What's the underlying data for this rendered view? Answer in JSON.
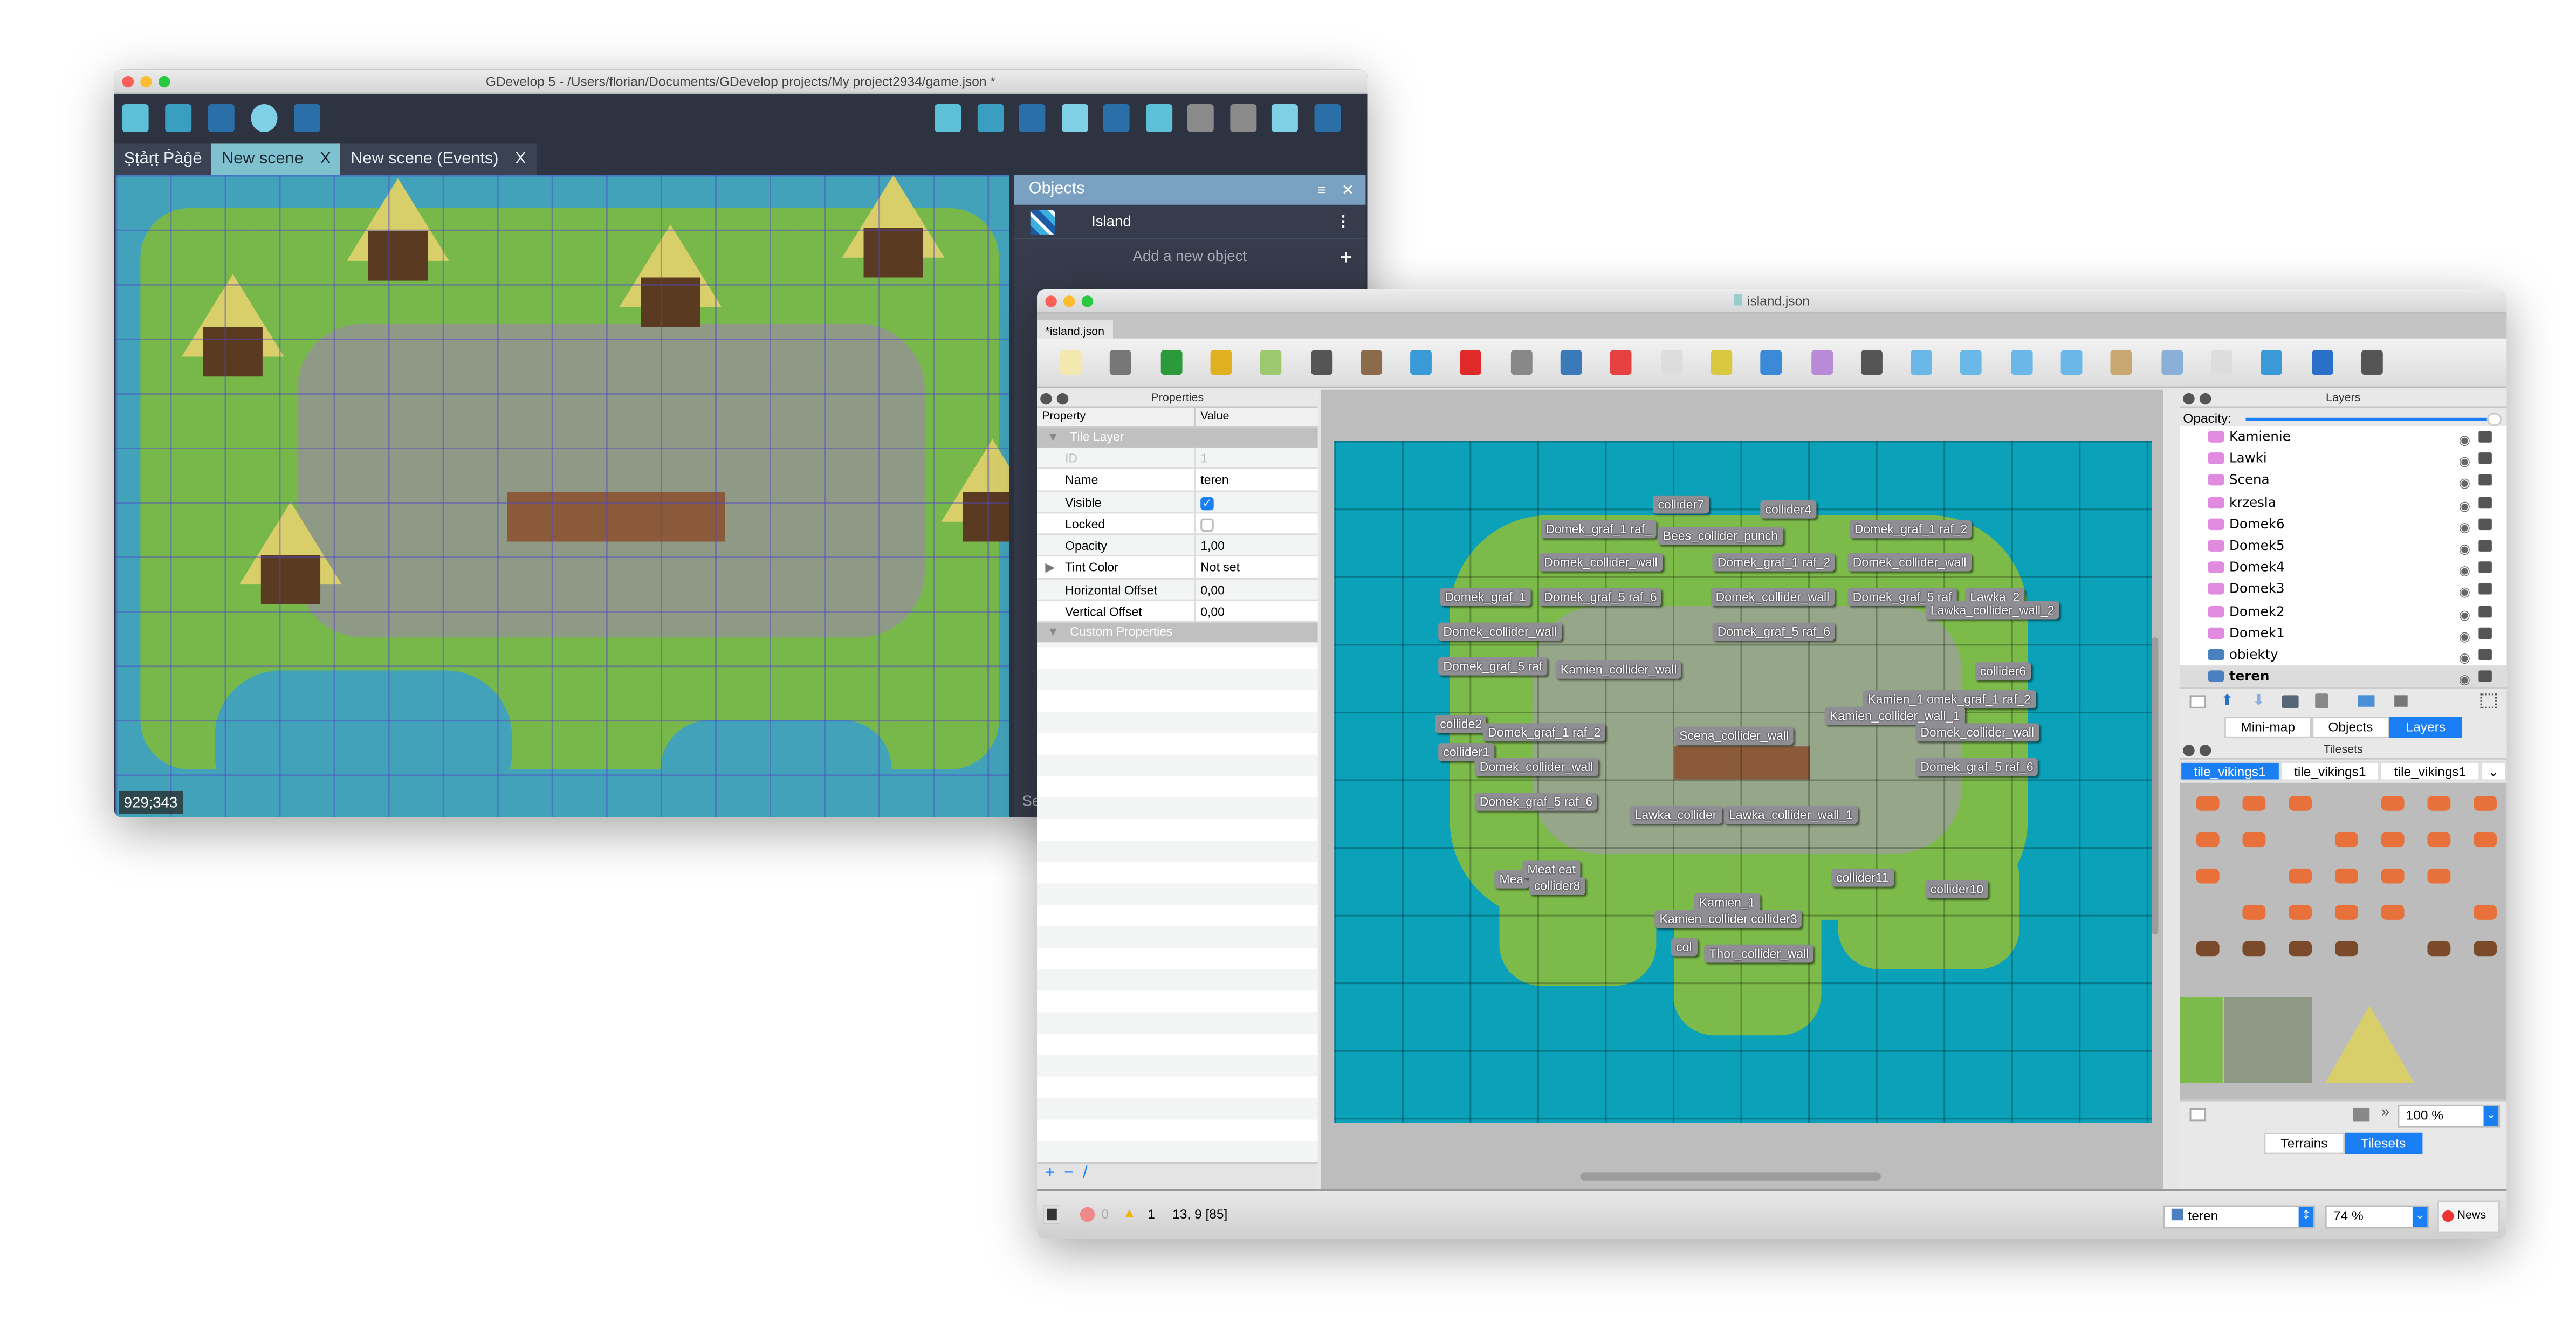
{
  "editor_window": {
    "title": "GDevelop 5 - /Users/florian/Documents/GDevelop projects/My project2934/game.json *",
    "toolbar_left_icons": [
      "project-manager-icon",
      "scene-editor-icon",
      "debugger-icon",
      "preview-play-icon",
      "network-preview-icon"
    ],
    "toolbar_right_icons": [
      "add-instance-icon",
      "instances-list-icon",
      "properties-icon",
      "layers-icon",
      "object-groups-icon",
      "undo-icon",
      "redo-icon",
      "window-mask-icon",
      "grid-icon",
      "zoom-icon"
    ],
    "tabs": [
      {
        "label": "Ṣṭảṛṭ Ṗàĝē",
        "closable": false,
        "active": false
      },
      {
        "label": "New scene",
        "closable": true,
        "active": false
      },
      {
        "label": "New scene (Events)",
        "closable": true,
        "active": false
      }
    ],
    "close_glyph": "X",
    "cursor_coordinates": "929;343",
    "objects_panel": {
      "title": "Objects",
      "items": [
        {
          "name": "Island",
          "icon": "tilemap-icon"
        }
      ],
      "add_label": "Add a new object",
      "truncated_footer": "Se"
    }
  },
  "tiled_window": {
    "title": "island.json",
    "document_tab": "*island.json",
    "toolbar_icons": [
      "new-map-icon",
      "open-icon",
      "save-icon",
      "undo-icon",
      "redo-icon",
      "random-mode-icon",
      "stamp-brush-icon",
      "terrain-brush-icon",
      "wang-brush-icon",
      "bucket-fill-icon",
      "shape-fill-icon",
      "eraser-icon",
      "rectangular-select-icon",
      "magic-wand-icon",
      "select-same-tile-icon",
      "select-objects-icon",
      "edit-polygons-icon",
      "insert-rectangle-icon",
      "insert-point-icon",
      "insert-ellipse-icon",
      "insert-polygon-icon",
      "insert-tile-icon",
      "insert-template-icon",
      "insert-text-icon",
      "world-tool-icon",
      "move-tool-icon",
      "more-tools-icon"
    ],
    "properties": {
      "title": "Properties",
      "col_property": "Property",
      "col_value": "Value",
      "group": "Tile Layer",
      "rows": [
        {
          "key": "ID",
          "value": "1",
          "disabled": true
        },
        {
          "key": "Name",
          "value": "teren"
        },
        {
          "key": "Visible",
          "checked": true
        },
        {
          "key": "Locked",
          "checked": false
        },
        {
          "key": "Opacity",
          "value": "1,00"
        },
        {
          "key": "Tint Color",
          "value": "Not set",
          "expandable": true
        },
        {
          "key": "Horizontal Offset",
          "value": "0,00"
        },
        {
          "key": "Vertical Offset",
          "value": "0,00"
        }
      ],
      "custom_group": "Custom Properties"
    },
    "map_labels": [
      "collider7",
      "collider4",
      "Domek_graf_1 raf_",
      "Bees_collider_punch",
      "Domek_graf_1 raf_2",
      "Domek_collider_wall",
      "Domek_graf_1 raf_2",
      "Domek_collider_wall",
      "Domek_graf_1",
      "Domek_graf_5 raf_6",
      "Domek_collider_wall",
      "Domek_graf_5 raf",
      "Lawka_2",
      "Lawka_collider_wall_2",
      "Domek_collider_wall",
      "Domek_graf_5 raf_6",
      "Domek_graf_5 raf",
      "Kamien_collider_wall",
      "collider6",
      "Kamien_1 omek_graf_1 raf_2",
      "Kamien_collider_wall_1",
      "collide2",
      "Domek_graf_1 raf_2",
      "Scena_collider_wall",
      "Domek_collider_wall",
      "collider1",
      "Domek_collider_wall",
      "Domek_graf_5 raf_6",
      "Domek_graf_5 raf_6",
      "Lawka_collider",
      "Lawka_collider_wall_1",
      "Mea",
      "Meat eat",
      "collider8",
      "collider11",
      "collider10",
      "Kamien_1",
      "Kamien_collider collider3",
      "col",
      "Thor_collider_wall"
    ],
    "layers": {
      "title": "Layers",
      "opacity_label": "Opacity:",
      "opacity": 1.0,
      "items": [
        {
          "name": "Kamienie",
          "type": "object"
        },
        {
          "name": "Lawki",
          "type": "object"
        },
        {
          "name": "Scena",
          "type": "object"
        },
        {
          "name": "krzesla",
          "type": "object"
        },
        {
          "name": "Domek6",
          "type": "object"
        },
        {
          "name": "Domek5",
          "type": "object"
        },
        {
          "name": "Domek4",
          "type": "object"
        },
        {
          "name": "Domek3",
          "type": "object"
        },
        {
          "name": "Domek2",
          "type": "object"
        },
        {
          "name": "Domek1",
          "type": "object"
        },
        {
          "name": "obiekty",
          "type": "tile"
        },
        {
          "name": "teren",
          "type": "tile",
          "selected": true
        }
      ],
      "dock_tabs": [
        {
          "label": "Mini-map"
        },
        {
          "label": "Objects"
        },
        {
          "label": "Layers",
          "active": true
        }
      ]
    },
    "tilesets": {
      "title": "Tilesets",
      "tabs": [
        {
          "label": "tile_vikings1",
          "active": true
        },
        {
          "label": "tile_vikings1"
        },
        {
          "label": "tile_vikings1"
        }
      ],
      "zoom": "100 %",
      "dock_tabs": [
        {
          "label": "Terrains"
        },
        {
          "label": "Tilesets",
          "active": true
        }
      ]
    },
    "status": {
      "errors": "0",
      "warnings": "1",
      "position": "13, 9 [85]",
      "current_layer": "teren",
      "zoom": "74 %",
      "news": "News"
    }
  },
  "colors": {
    "gdevelop_dark": "#2d3340",
    "gdevelop_accent": "#7fc1cf",
    "panel_header": "#7aa1c1",
    "tiled_accent": "#1a7ff5",
    "map_water": "#0aa1b9",
    "grass": "#7cba4a",
    "label_bg": "#8f8e94"
  }
}
